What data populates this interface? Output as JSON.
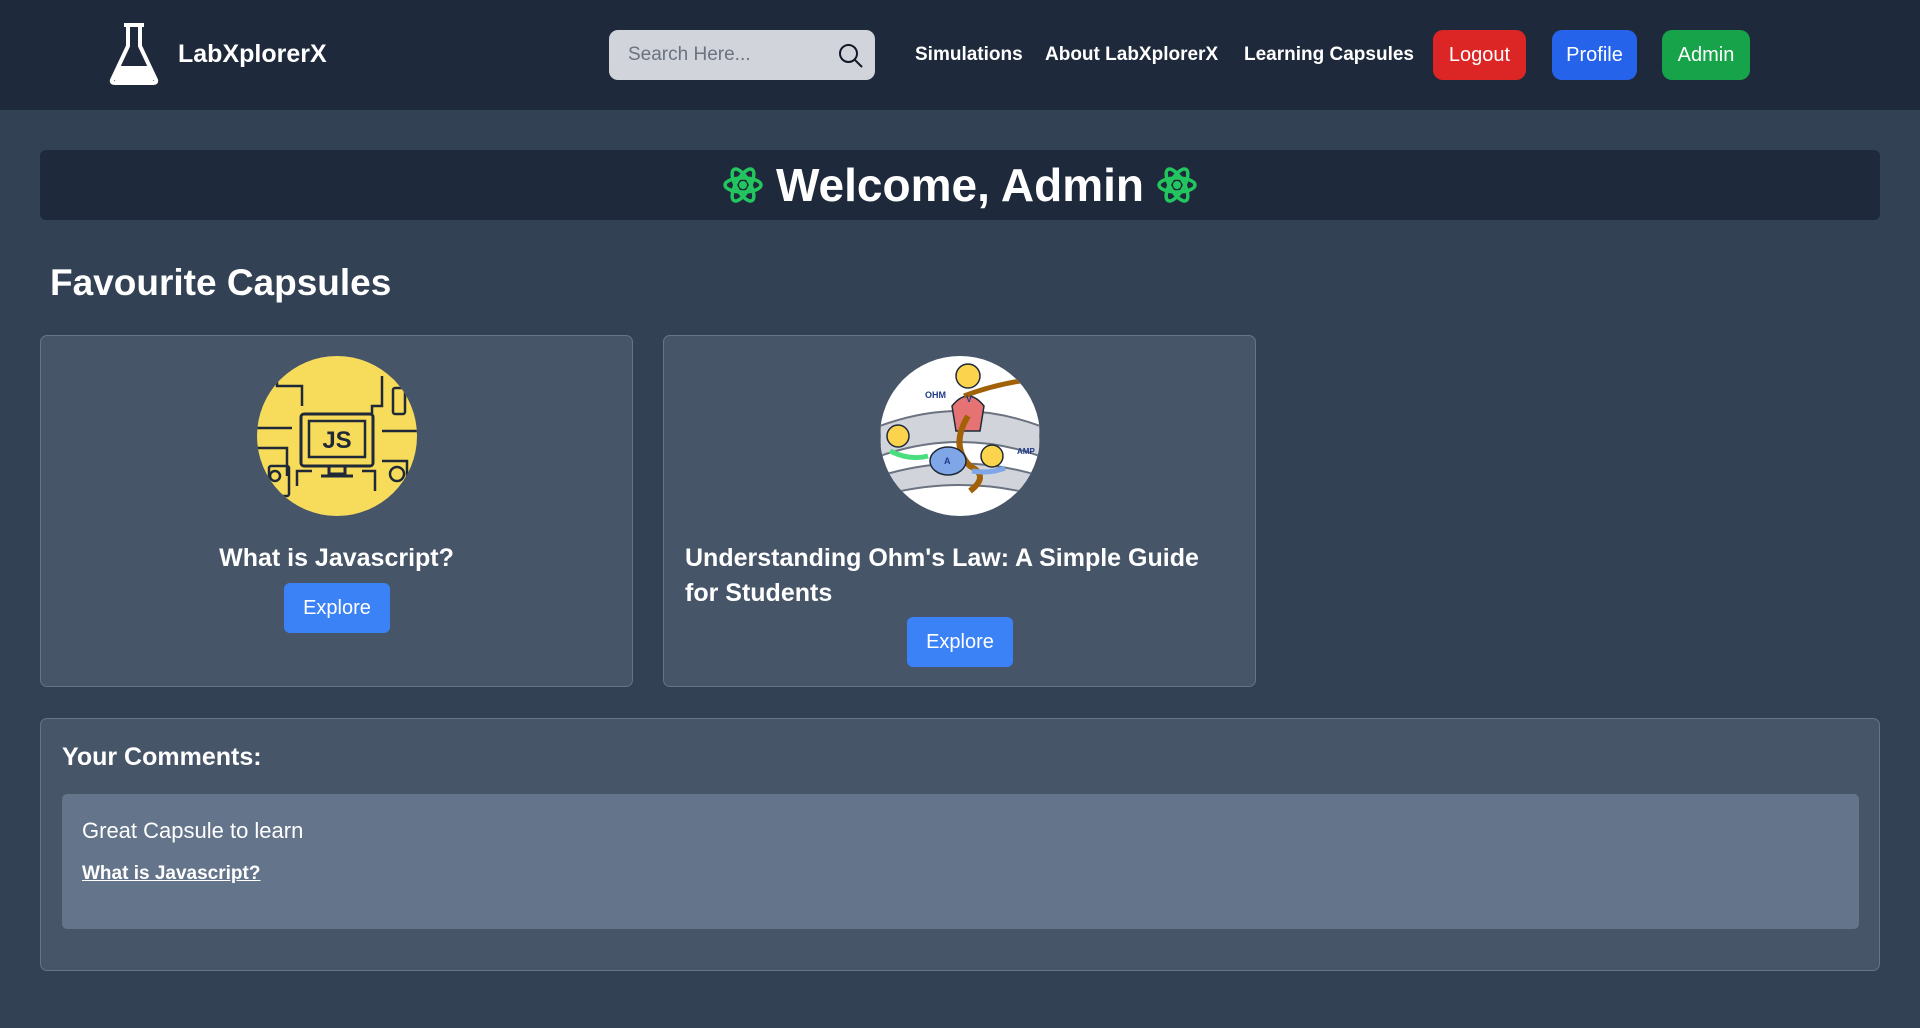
{
  "header": {
    "brand": "LabXplorerX",
    "search_placeholder": "Search Here...",
    "nav_links": [
      "Simulations",
      "About LabXplorerX",
      "Learning Capsules"
    ],
    "buttons": {
      "logout": "Logout",
      "profile": "Profile",
      "admin": "Admin"
    }
  },
  "welcome": {
    "text": "Welcome, Admin"
  },
  "favourites": {
    "title": "Favourite Capsules",
    "cards": [
      {
        "title": "What is Javascript?",
        "button": "Explore",
        "thumb_label": "JS"
      },
      {
        "title": "Understanding Ohm's Law: A Simple Guide for Students",
        "button": "Explore",
        "thumb_labels": [
          "OHM",
          "V",
          "A",
          "AMP"
        ]
      }
    ]
  },
  "comments": {
    "title": "Your Comments:",
    "items": [
      {
        "text": "Great Capsule to learn",
        "link": "What is Javascript?"
      }
    ]
  },
  "colors": {
    "page_bg": "#334155",
    "navbar_bg": "#1e293b",
    "card_bg": "#475569",
    "comment_bg": "#64748b",
    "logout": "#dc2626",
    "profile": "#2563eb",
    "admin": "#16a34a",
    "explore": "#3b82f6",
    "atom": "#22c55e"
  },
  "icons": [
    "flask-icon",
    "search-icon",
    "atom-icon"
  ]
}
